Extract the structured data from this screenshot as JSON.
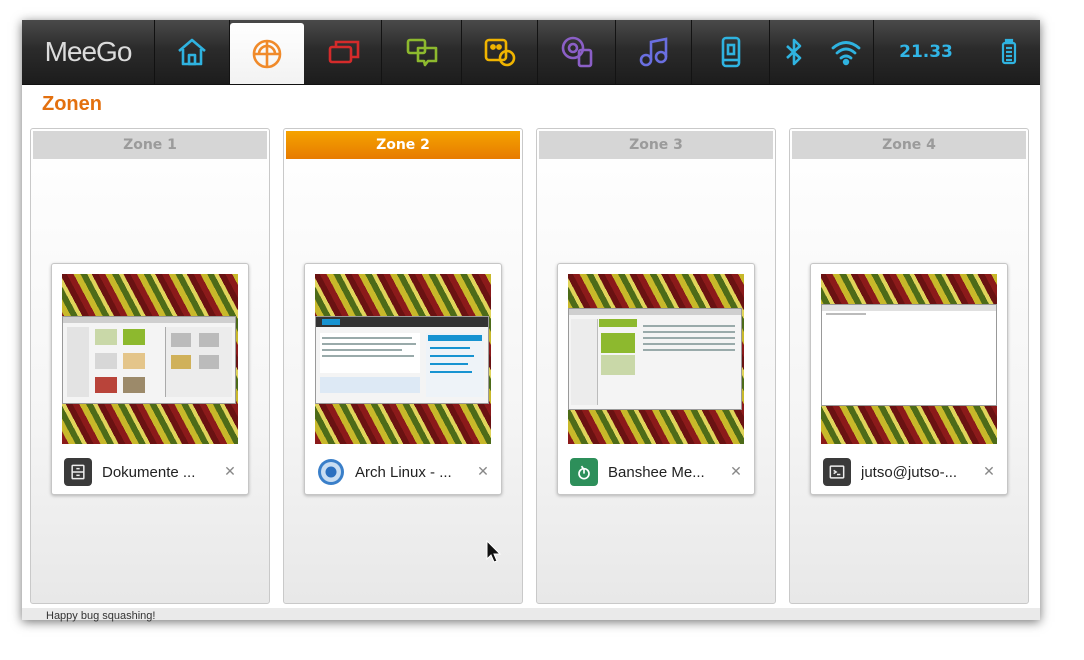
{
  "brand": "MeeGo",
  "title": "Zonen",
  "status": {
    "clock": "21.33"
  },
  "toolbar": [
    {
      "name": "home-icon",
      "color": "#2fb3e0"
    },
    {
      "name": "zones-icon",
      "color": "#f08a2a",
      "active": true
    },
    {
      "name": "windows-icon",
      "color": "#d42b2b"
    },
    {
      "name": "chat-icon",
      "color": "#8db92e"
    },
    {
      "name": "people-icon",
      "color": "#f0b400"
    },
    {
      "name": "media-icon",
      "color": "#8b5fc7"
    },
    {
      "name": "music-icon",
      "color": "#6a6fe0"
    },
    {
      "name": "device-icon",
      "color": "#2fb3e0"
    },
    {
      "name": "bluetooth-icon",
      "color": "#2fb3e0"
    },
    {
      "name": "wifi-icon",
      "color": "#2fb3e0"
    },
    {
      "name": "battery-icon",
      "color": "#2fb3e0"
    }
  ],
  "zones": [
    {
      "label": "Zone 1",
      "active": false,
      "app": {
        "title": "Dokumente ...",
        "icon": "file-manager-icon"
      }
    },
    {
      "label": "Zone 2",
      "active": true,
      "app": {
        "title": "Arch Linux - ...",
        "icon": "chromium-icon"
      }
    },
    {
      "label": "Zone 3",
      "active": false,
      "app": {
        "title": "Banshee Me...",
        "icon": "banshee-icon"
      }
    },
    {
      "label": "Zone 4",
      "active": false,
      "app": {
        "title": "jutso@jutso-...",
        "icon": "terminal-icon"
      }
    }
  ],
  "background_text": "Happy bug squashing!"
}
